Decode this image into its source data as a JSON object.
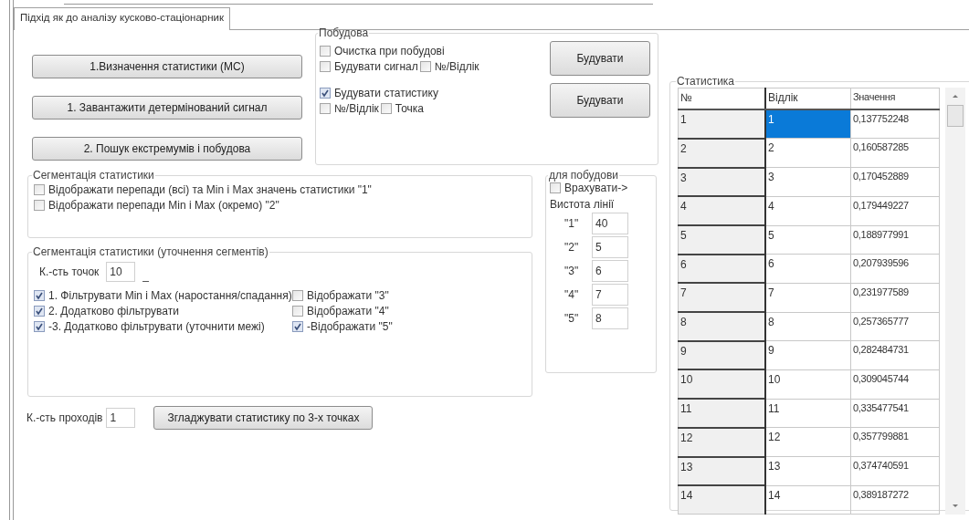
{
  "tabs": [
    {
      "label": "Підхід як до аналізу кусково-стаціонарник",
      "selected": true
    }
  ],
  "actions": [
    "1.Визначення статистики (МС)",
    "1. Завантажити детермінований сигнал",
    "2. Пошук екстремумів і побудова"
  ],
  "build": {
    "title": "Побудова",
    "sections": [
      {
        "lines": [
          [
            {
              "label": "Очистка при побудові",
              "checked": false
            }
          ],
          [
            {
              "label": "Будувати сигнал",
              "checked": false
            },
            {
              "label": "№/Відлік",
              "checked": false
            }
          ]
        ],
        "button": "Будувати"
      },
      {
        "lines": [
          [
            {
              "label": "Будувати статистику",
              "checked": true
            }
          ],
          [
            {
              "label": "№/Відлік",
              "checked": false
            },
            {
              "label": "Точка",
              "checked": false
            }
          ]
        ],
        "button": "Будувати"
      }
    ]
  },
  "segmentation": {
    "title": "Сегментація статистики",
    "checks": [
      {
        "label": "Відображати перепади (всі)  та Min і Max значень статистики \"1\"",
        "checked": false
      },
      {
        "label": "Відображати перепади Min і Max (окремо)  \"2\"",
        "checked": false
      }
    ]
  },
  "refinement": {
    "title": "Сегментація статистики (уточнення сегментів)",
    "points_label": "К.-сть точок",
    "points_value": "10",
    "marker": "_",
    "rows": [
      {
        "filter": {
          "label": "1. Фільтрувати Min і Max (наростання/спадання)",
          "checked": true
        },
        "show": {
          "label": "Відображати \"3\"",
          "checked": false
        }
      },
      {
        "filter": {
          "label": "2. Додатково фільтрувати",
          "checked": true
        },
        "show": {
          "label": "Відображати \"4\"",
          "checked": false
        }
      },
      {
        "filter": {
          "label": "-3. Додатково фільтрувати (уточнити межі)",
          "checked": true
        },
        "show": {
          "label": "-Відображати \"5\"",
          "checked": true
        }
      }
    ]
  },
  "plot": {
    "title": "для побудови",
    "account": {
      "label": "Врахувати->",
      "checked": false
    },
    "height_label": "Вистота лінії",
    "lines": [
      {
        "label": "\"1\"",
        "value": "40"
      },
      {
        "label": "\"2\"",
        "value": "5"
      },
      {
        "label": "\"3\"",
        "value": "6"
      },
      {
        "label": "\"4\"",
        "value": "7"
      },
      {
        "label": "\"5\"",
        "value": "8"
      }
    ]
  },
  "passes": {
    "label": "К.-сть проходів",
    "value": "1",
    "button": "Згладжувати статистику по 3-х точках"
  },
  "statistics": {
    "title": "Статистика",
    "columns": [
      "№",
      "Відлік",
      "Значення"
    ],
    "rows": [
      {
        "cells": [
          "1",
          "1",
          "0,137752248"
        ],
        "selected": true
      },
      {
        "cells": [
          "2",
          "2",
          "0,160587285"
        ],
        "selected": false
      },
      {
        "cells": [
          "3",
          "3",
          "0,170452889"
        ],
        "selected": false
      },
      {
        "cells": [
          "4",
          "4",
          "0,179449227"
        ],
        "selected": false
      },
      {
        "cells": [
          "5",
          "5",
          "0,188977991"
        ],
        "selected": false
      },
      {
        "cells": [
          "6",
          "6",
          "0,207939596"
        ],
        "selected": false
      },
      {
        "cells": [
          "7",
          "7",
          "0,231977589"
        ],
        "selected": false
      },
      {
        "cells": [
          "8",
          "8",
          "0,257365777"
        ],
        "selected": false
      },
      {
        "cells": [
          "9",
          "9",
          "0,282484731"
        ],
        "selected": false
      },
      {
        "cells": [
          "10",
          "10",
          "0,309045744"
        ],
        "selected": false
      },
      {
        "cells": [
          "11",
          "11",
          "0,335477541"
        ],
        "selected": false
      },
      {
        "cells": [
          "12",
          "12",
          "0,357799881"
        ],
        "selected": false
      },
      {
        "cells": [
          "13",
          "13",
          "0,374740591"
        ],
        "selected": false
      },
      {
        "cells": [
          "14",
          "14",
          "0,389187272"
        ],
        "selected": false
      }
    ]
  }
}
